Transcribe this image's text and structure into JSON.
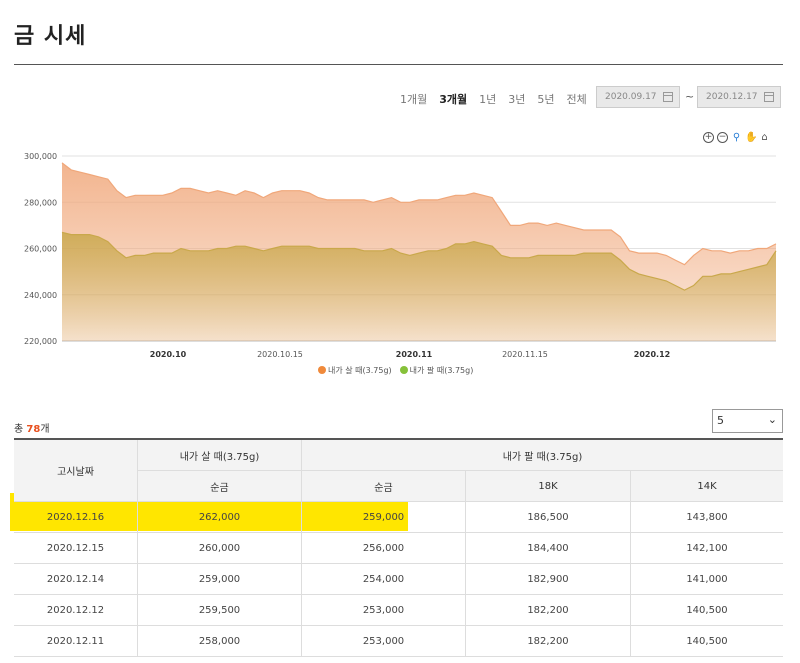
{
  "title": "금 시세",
  "periods": [
    "1개월",
    "3개월",
    "1년",
    "3년",
    "5년",
    "전체"
  ],
  "active_period": "3개월",
  "date_from": "2020.09.17",
  "date_to": "2020.12.17",
  "tilde": "~",
  "colors": {
    "buy": "#f0a77a",
    "sell": "#c9a84b",
    "legend_buy": "#f08a3b",
    "legend_sell": "#86c13a",
    "highlight": "#ffe600",
    "count": "#e8501e"
  },
  "legend": {
    "buy": "내가 살 때(3.75g)",
    "sell": "내가 팔 때(3.75g)"
  },
  "chart_data": {
    "type": "area",
    "ylim": [
      220000,
      300000
    ],
    "yticks": [
      "300,000",
      "280,000",
      "260,000",
      "240,000",
      "220,000"
    ],
    "xticks": [
      {
        "label": "2020.10",
        "bold": true
      },
      {
        "label": "2020.10.15",
        "bold": false
      },
      {
        "label": "2020.11",
        "bold": true
      },
      {
        "label": "2020.11.15",
        "bold": false
      },
      {
        "label": "2020.12",
        "bold": true
      }
    ],
    "series": [
      {
        "name": "내가 살 때(3.75g)",
        "values": [
          297000,
          294000,
          293000,
          292000,
          291000,
          290000,
          285000,
          282000,
          283000,
          283000,
          283000,
          283000,
          284000,
          286000,
          286000,
          285000,
          284000,
          285000,
          284000,
          283000,
          285000,
          284000,
          282000,
          284000,
          285000,
          285000,
          285000,
          284000,
          282000,
          281000,
          281000,
          281000,
          281000,
          281000,
          280000,
          281000,
          282000,
          280000,
          280000,
          281000,
          281000,
          281000,
          282000,
          283000,
          283000,
          284000,
          283000,
          282000,
          276000,
          270000,
          270000,
          271000,
          271000,
          270000,
          271000,
          270000,
          269000,
          268000,
          268000,
          268000,
          268000,
          265000,
          259000,
          258000,
          258000,
          258000,
          257000,
          255000,
          253000,
          257000,
          260000,
          259000,
          259000,
          258000,
          259000,
          259000,
          260000,
          260000,
          262000
        ]
      },
      {
        "name": "내가 팔 때(3.75g)",
        "values": [
          267000,
          266000,
          266000,
          266000,
          265000,
          263000,
          259000,
          256000,
          257000,
          257000,
          258000,
          258000,
          258000,
          260000,
          259000,
          259000,
          259000,
          260000,
          260000,
          261000,
          261000,
          260000,
          259000,
          260000,
          261000,
          261000,
          261000,
          261000,
          260000,
          260000,
          260000,
          260000,
          260000,
          259000,
          259000,
          259000,
          260000,
          258000,
          257000,
          258000,
          259000,
          259000,
          260000,
          262000,
          262000,
          263000,
          262000,
          261000,
          257000,
          256000,
          256000,
          256000,
          257000,
          257000,
          257000,
          257000,
          257000,
          258000,
          258000,
          258000,
          258000,
          255000,
          251000,
          249000,
          248000,
          247000,
          246000,
          244000,
          242000,
          244000,
          248000,
          248000,
          249000,
          249000,
          250000,
          251000,
          252000,
          253000,
          259000
        ]
      }
    ]
  },
  "count": {
    "prefix": "총 ",
    "value": "78",
    "suffix": "개"
  },
  "page_size": "5",
  "table": {
    "h_date": "고시날짜",
    "h_buy": "내가 살 때(3.75g)",
    "h_sell": "내가 팔 때(3.75g)",
    "h_pure_buy": "순금",
    "h_pure_sell": "순금",
    "h_18k": "18K",
    "h_14k": "14K",
    "rows": [
      [
        "2020.12.16",
        "262,000",
        "259,000",
        "186,500",
        "143,800"
      ],
      [
        "2020.12.15",
        "260,000",
        "256,000",
        "184,400",
        "142,100"
      ],
      [
        "2020.12.14",
        "259,000",
        "254,000",
        "182,900",
        "141,000"
      ],
      [
        "2020.12.12",
        "259,500",
        "253,000",
        "182,200",
        "140,500"
      ],
      [
        "2020.12.11",
        "258,000",
        "253,000",
        "182,200",
        "140,500"
      ]
    ]
  }
}
